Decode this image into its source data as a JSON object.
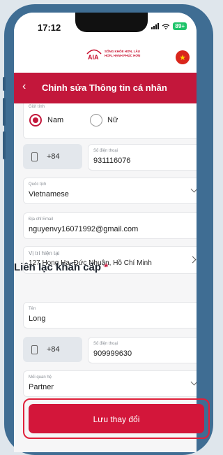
{
  "status_bar": {
    "time": "17:12",
    "battery": "89+"
  },
  "header": {
    "tagline": "SỐNG KHỎE HƠN, LÂU HƠN, HẠNH PHÚC HƠN",
    "flag_icon": "vietnam-flag-icon"
  },
  "title_bar": {
    "back_icon": "chevron-left-icon",
    "title": "Chỉnh sửa Thông tin cá nhân"
  },
  "form": {
    "gender": {
      "label": "Giới tính",
      "options": [
        "Nam",
        "Nữ"
      ],
      "selected": "Nam"
    },
    "phone": {
      "prefix": "+84",
      "label": "Số điện thoại",
      "value": "931116076"
    },
    "nationality": {
      "label": "Quốc tịch",
      "value": "Vietnamese"
    },
    "email": {
      "label": "Địa chỉ Email",
      "value": "nguyenvy16071992@gmail.com"
    },
    "location": {
      "label": "Vị trí hiện tại",
      "value": "127 Hong Ha, Đức Nhuận, Hồ Chí Minh"
    }
  },
  "emergency": {
    "title": "Liên lạc khẩn cấp",
    "required_mark": "*",
    "name": {
      "label": "Tên",
      "value": "Long"
    },
    "phone": {
      "prefix": "+84",
      "label": "Số điện thoại",
      "value": "909999630"
    },
    "relation": {
      "label": "Mối quan hệ",
      "value": "Partner"
    }
  },
  "save_label": "Lưu thay đổi",
  "colors": {
    "brand_red": "#c3173b",
    "phone_frame": "#3f6d93"
  }
}
